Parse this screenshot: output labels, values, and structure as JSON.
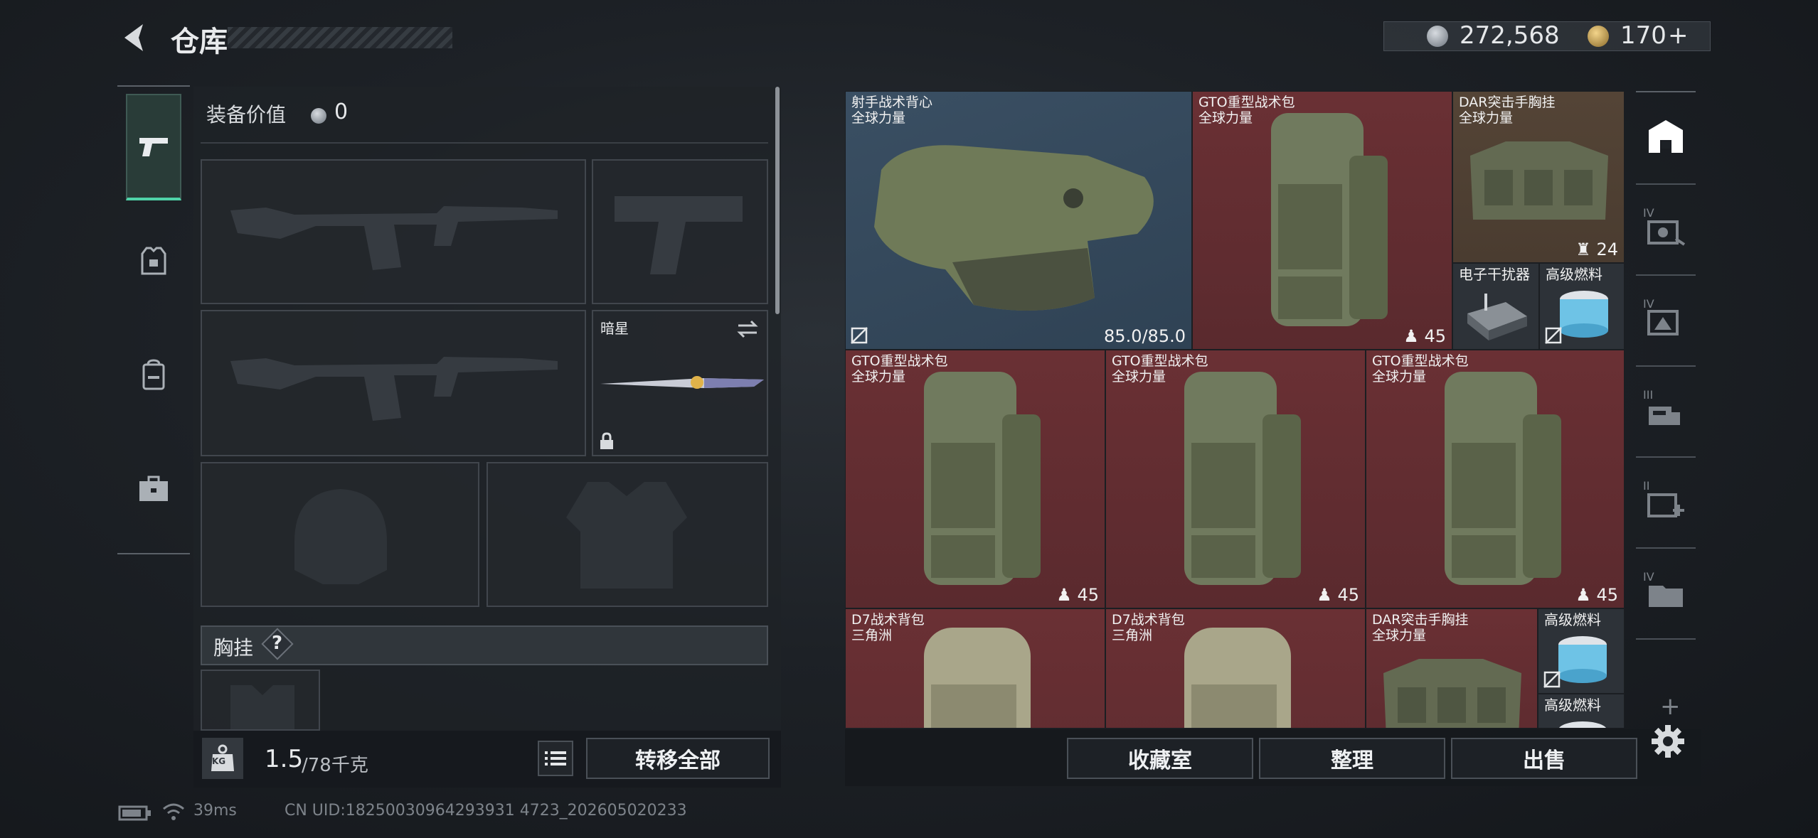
{
  "header": {
    "title": "仓库",
    "currency_amount": "272,568",
    "premium_amount": "170",
    "premium_add": "+"
  },
  "nav_icons": [
    "pistol-icon",
    "armor-icon",
    "backpack-icon",
    "briefcase-icon"
  ],
  "equipment": {
    "value_label": "装备价值",
    "value": "0",
    "melee_name": "暗星",
    "chest_rig_label": "胸挂",
    "help_mark": "?",
    "weight_current": "1.5",
    "weight_max": "/78千克",
    "weight_badge": "KG",
    "transfer_all": "转移全部"
  },
  "stash_items": [
    {
      "name": "射手战术背心",
      "sub": "全球力量",
      "durability": "85.0/85.0",
      "color": "blue"
    },
    {
      "name": "GTO重型战术包",
      "sub": "全球力量",
      "count": "45",
      "color": "red"
    },
    {
      "name": "DAR突击手胸挂",
      "sub": "全球力量",
      "count": "24",
      "color": "brown"
    },
    {
      "name": "电子干扰器",
      "color": "gray"
    },
    {
      "name": "高级燃料",
      "color": "gray"
    },
    {
      "name": "GTO重型战术包",
      "sub": "全球力量",
      "count": "45",
      "color": "red"
    },
    {
      "name": "GTO重型战术包",
      "sub": "全球力量",
      "count": "45",
      "color": "red"
    },
    {
      "name": "GTO重型战术包",
      "sub": "全球力量",
      "count": "45",
      "color": "red"
    },
    {
      "name": "D7战术背包",
      "sub": "三角洲",
      "color": "red"
    },
    {
      "name": "D7战术背包",
      "sub": "三角洲",
      "color": "red"
    },
    {
      "name": "DAR突击手胸挂",
      "sub": "全球力量",
      "color": "red"
    },
    {
      "name": "高级燃料",
      "color": "gray"
    },
    {
      "name": "高级燃料",
      "color": "gray"
    }
  ],
  "side_tabs": [
    {
      "icon": "stash-icon"
    },
    {
      "tier": "IV"
    },
    {
      "tier": "IV"
    },
    {
      "tier": "III"
    },
    {
      "tier": "II"
    },
    {
      "tier": "IV"
    }
  ],
  "bottom_buttons": {
    "collection": "收藏室",
    "sort": "整理",
    "sell": "出售"
  },
  "status_bar": {
    "ping": "39ms",
    "uid": "CN UID:18250030964293931 4723_202605020233"
  }
}
